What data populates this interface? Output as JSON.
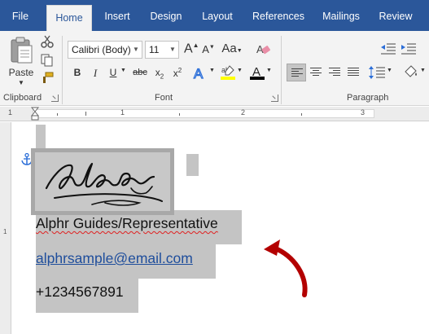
{
  "tabs": [
    "File",
    "Home",
    "Insert",
    "Design",
    "Layout",
    "References",
    "Mailings",
    "Review"
  ],
  "active_tab": "Home",
  "ribbon": {
    "clipboard": {
      "paste_label": "Paste",
      "group_label": "Clipboard"
    },
    "font": {
      "font_name": "Calibri (Body)",
      "font_size": "11",
      "grow_label": "A",
      "shrink_label": "A",
      "change_case_label": "Aa",
      "bold": "B",
      "italic": "I",
      "underline": "U",
      "strikethrough": "abc",
      "subscript": "x",
      "subscript_mark": "2",
      "superscript": "x",
      "superscript_mark": "2",
      "highlight_color": "#ffff00",
      "font_color": "#000000",
      "group_label": "Font"
    },
    "paragraph": {
      "group_label": "Paragraph"
    }
  },
  "ruler": {
    "numbers": [
      "1",
      "1",
      "2",
      "3"
    ]
  },
  "document": {
    "line1": "Alphr Guides/Representative",
    "line2": "alphrsample@email.com",
    "line3": "+1234567891"
  },
  "colors": {
    "ribbon_blue": "#2b579a",
    "link_blue": "#1f4e9c",
    "selection_gray": "#c4c4c4",
    "arrow_red": "#b30000"
  }
}
